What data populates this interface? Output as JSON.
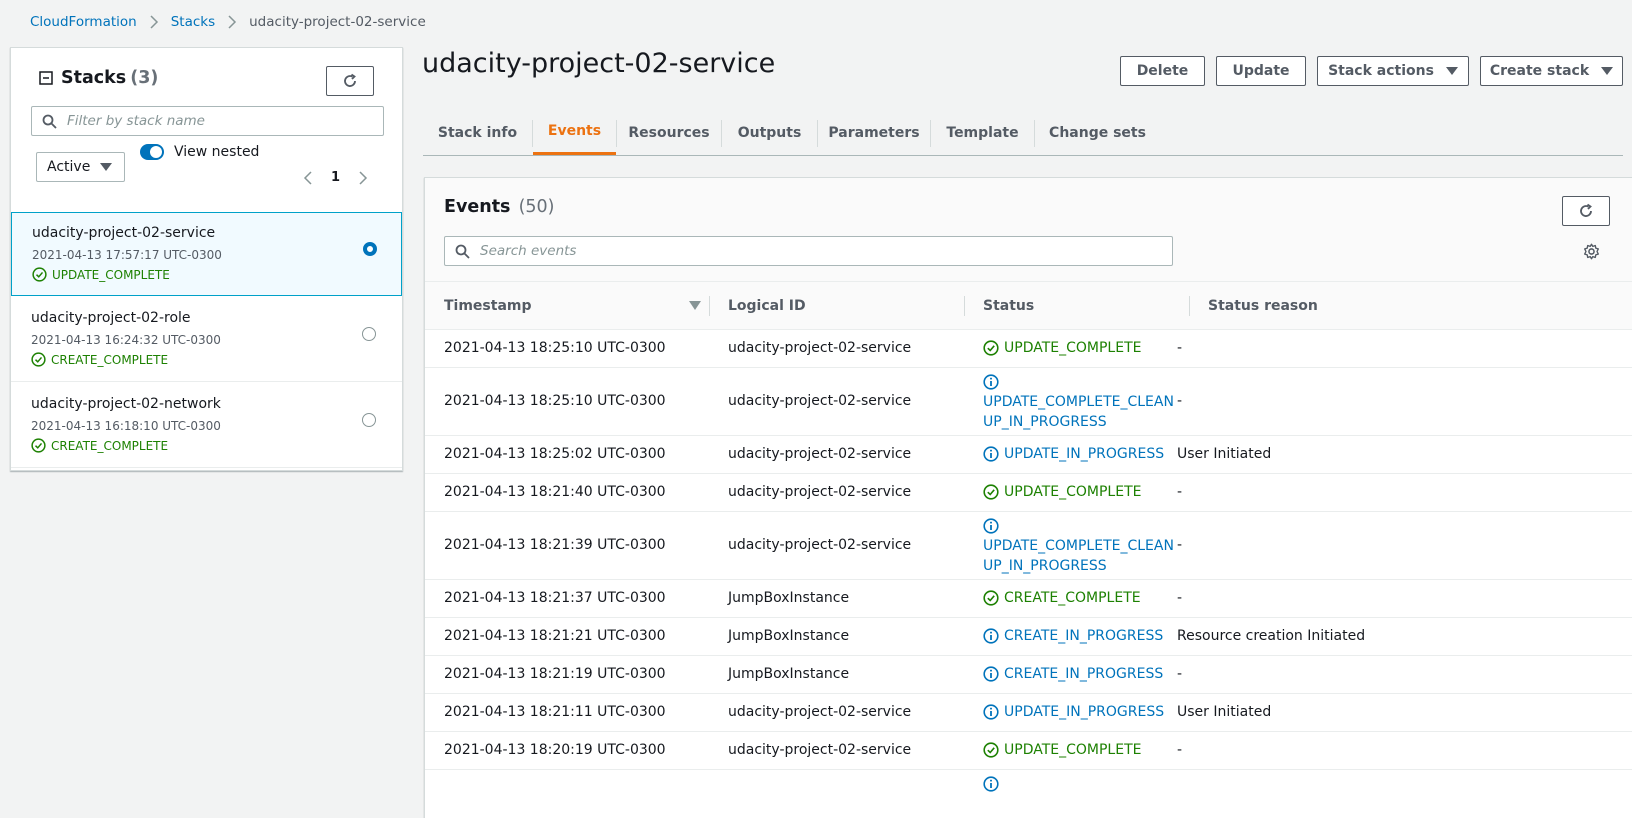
{
  "breadcrumb": {
    "root": "CloudFormation",
    "stacks": "Stacks",
    "current": "udacity-project-02-service"
  },
  "sidebar": {
    "title": "Stacks",
    "count": "(3)",
    "filter_placeholder": "Filter by stack name",
    "status_filter": "Active",
    "view_nested_label": "View nested",
    "page": "1",
    "stacks": [
      {
        "name": "udacity-project-02-service",
        "time": "2021-04-13 17:57:17 UTC-0300",
        "status": "UPDATE_COMPLETE",
        "selected": true
      },
      {
        "name": "udacity-project-02-role",
        "time": "2021-04-13 16:24:32 UTC-0300",
        "status": "CREATE_COMPLETE",
        "selected": false
      },
      {
        "name": "udacity-project-02-network",
        "time": "2021-04-13 16:18:10 UTC-0300",
        "status": "CREATE_COMPLETE",
        "selected": false
      }
    ]
  },
  "header": {
    "title": "udacity-project-02-service",
    "delete_label": "Delete",
    "update_label": "Update",
    "stack_actions_label": "Stack actions",
    "create_stack_label": "Create stack"
  },
  "tabs": [
    "Stack info",
    "Events",
    "Resources",
    "Outputs",
    "Parameters",
    "Template",
    "Change sets"
  ],
  "active_tab": "Events",
  "events": {
    "title": "Events",
    "count": "(50)",
    "search_placeholder": "Search events",
    "columns": [
      "Timestamp",
      "Logical ID",
      "Status",
      "Status reason"
    ],
    "rows": [
      {
        "timestamp": "2021-04-13 18:25:10 UTC-0300",
        "logical_id": "udacity-project-02-service",
        "status": "UPDATE_COMPLETE",
        "status_lines": [],
        "kind": "ok",
        "reason": "-"
      },
      {
        "timestamp": "2021-04-13 18:25:10 UTC-0300",
        "logical_id": "udacity-project-02-service",
        "status": "UPDATE_COMPLETE_CLEANUP_IN_PROGRESS",
        "status_lines": [
          "UPDATE_COMPLETE_CLEAN",
          "UP_IN_PROGRESS"
        ],
        "kind": "info",
        "reason": "-"
      },
      {
        "timestamp": "2021-04-13 18:25:02 UTC-0300",
        "logical_id": "udacity-project-02-service",
        "status": "UPDATE_IN_PROGRESS",
        "status_lines": [],
        "kind": "info",
        "reason": "User Initiated"
      },
      {
        "timestamp": "2021-04-13 18:21:40 UTC-0300",
        "logical_id": "udacity-project-02-service",
        "status": "UPDATE_COMPLETE",
        "status_lines": [],
        "kind": "ok",
        "reason": "-"
      },
      {
        "timestamp": "2021-04-13 18:21:39 UTC-0300",
        "logical_id": "udacity-project-02-service",
        "status": "UPDATE_COMPLETE_CLEANUP_IN_PROGRESS",
        "status_lines": [
          "UPDATE_COMPLETE_CLEAN",
          "UP_IN_PROGRESS"
        ],
        "kind": "info",
        "reason": "-"
      },
      {
        "timestamp": "2021-04-13 18:21:37 UTC-0300",
        "logical_id": "JumpBoxInstance",
        "status": "CREATE_COMPLETE",
        "status_lines": [],
        "kind": "ok",
        "reason": "-"
      },
      {
        "timestamp": "2021-04-13 18:21:21 UTC-0300",
        "logical_id": "JumpBoxInstance",
        "status": "CREATE_IN_PROGRESS",
        "status_lines": [],
        "kind": "info",
        "reason": "Resource creation Initiated"
      },
      {
        "timestamp": "2021-04-13 18:21:19 UTC-0300",
        "logical_id": "JumpBoxInstance",
        "status": "CREATE_IN_PROGRESS",
        "status_lines": [],
        "kind": "info",
        "reason": "-"
      },
      {
        "timestamp": "2021-04-13 18:21:11 UTC-0300",
        "logical_id": "udacity-project-02-service",
        "status": "UPDATE_IN_PROGRESS",
        "status_lines": [],
        "kind": "info",
        "reason": "User Initiated"
      },
      {
        "timestamp": "2021-04-13 18:20:19 UTC-0300",
        "logical_id": "udacity-project-02-service",
        "status": "UPDATE_COMPLETE",
        "status_lines": [],
        "kind": "ok",
        "reason": "-"
      },
      {
        "timestamp": "",
        "logical_id": "",
        "status": "",
        "status_lines": [],
        "kind": "info-partial",
        "reason": ""
      }
    ]
  },
  "colors": {
    "link": "#0073bb",
    "success": "#1d8102",
    "active_tab": "#ec7211",
    "selected_bg": "#f1faff",
    "selected_border": "#00a1c9"
  },
  "icons": {
    "refresh": "refresh-icon",
    "search": "search-icon",
    "settings": "gear-icon",
    "success": "check-circle-icon",
    "info": "info-circle-icon"
  }
}
